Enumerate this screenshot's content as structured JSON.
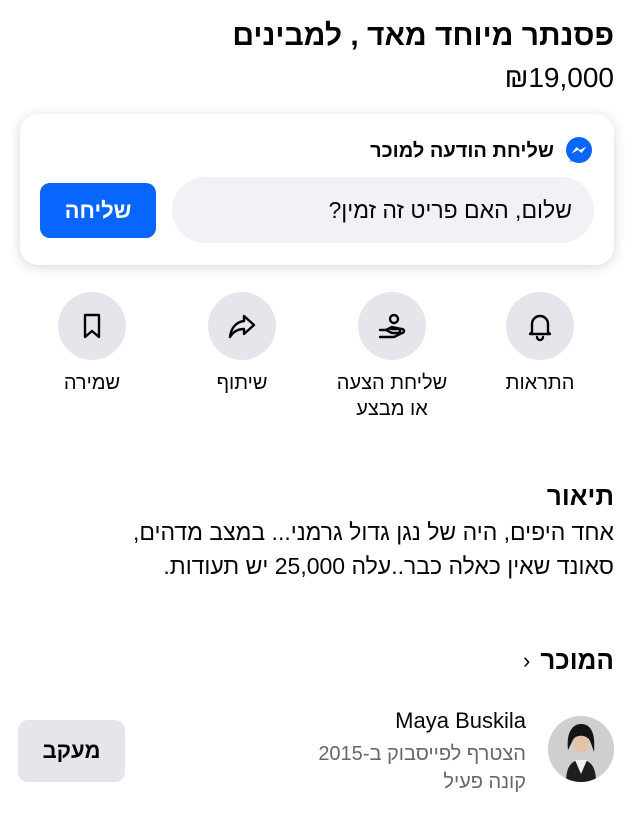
{
  "listing": {
    "title": "פסנתר מיוחד מאד , למבינים",
    "price": "₪19,000"
  },
  "message_card": {
    "heading": "שליחת הודעה למוכר",
    "input_value": "שלום, האם פריט זה זמין?",
    "send_label": "שליחה"
  },
  "actions": {
    "alerts": "התראות",
    "offer_line1": "שליחת הצעה",
    "offer_line2": "או מבצע",
    "share": "שיתוף",
    "save": "שמירה"
  },
  "description": {
    "heading": "תיאור",
    "line1": "אחד היפים, היה של נגן גדול גרמני... במצב מדהים,",
    "line2": "סאונד שאין כאלה כבר..עלה 25,000 יש תעודות."
  },
  "seller": {
    "heading": "המוכר",
    "chevron": "‹",
    "name": "Maya Buskila",
    "joined": "הצטרף לפייסבוק ב-2015",
    "status": "קונה פעיל",
    "follow_label": "מעקב"
  },
  "colors": {
    "accent": "#0866ff",
    "button_gray": "#e4e6eb",
    "input_bg": "#f0f2f5",
    "secondary_text": "#65676b"
  }
}
